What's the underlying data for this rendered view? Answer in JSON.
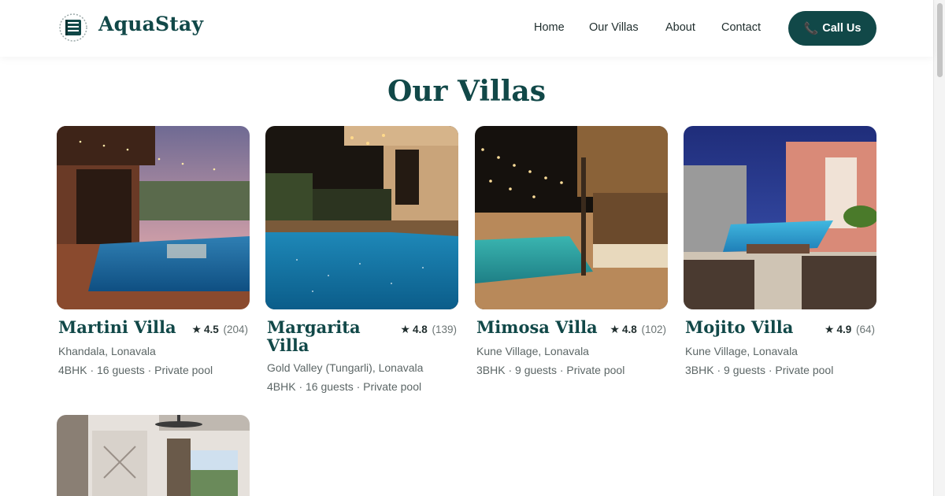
{
  "header": {
    "brand": "AquaStay",
    "logo_icon": "building-logo-icon",
    "nav": [
      {
        "label": "Home"
      },
      {
        "label": "Our Villas"
      },
      {
        "label": "About"
      },
      {
        "label": "Contact"
      }
    ],
    "cta": {
      "label": "Call Us",
      "icon": "phone-icon"
    }
  },
  "page": {
    "title": "Our Villas"
  },
  "villas": [
    {
      "name": "Martini Villa",
      "rating": "4.5",
      "reviews": "(204)",
      "location": "Khandala, Lonavala",
      "details": "4BHK · 16 guests · Private pool"
    },
    {
      "name": "Margarita Villa",
      "rating": "4.8",
      "reviews": "(139)",
      "location": "Gold Valley (Tungarli), Lonavala",
      "details": "4BHK · 16 guests · Private pool"
    },
    {
      "name": "Mimosa Villa",
      "rating": "4.8",
      "reviews": "(102)",
      "location": "Kune Village, Lonavala",
      "details": "3BHK · 9 guests · Private pool"
    },
    {
      "name": "Mojito Villa",
      "rating": "4.9",
      "reviews": "(64)",
      "location": "Kune Village, Lonavala",
      "details": "3BHK · 9 guests · Private pool"
    }
  ],
  "colors": {
    "brand": "#114848",
    "text": "#1f2d2d",
    "muted": "#5c6666"
  }
}
